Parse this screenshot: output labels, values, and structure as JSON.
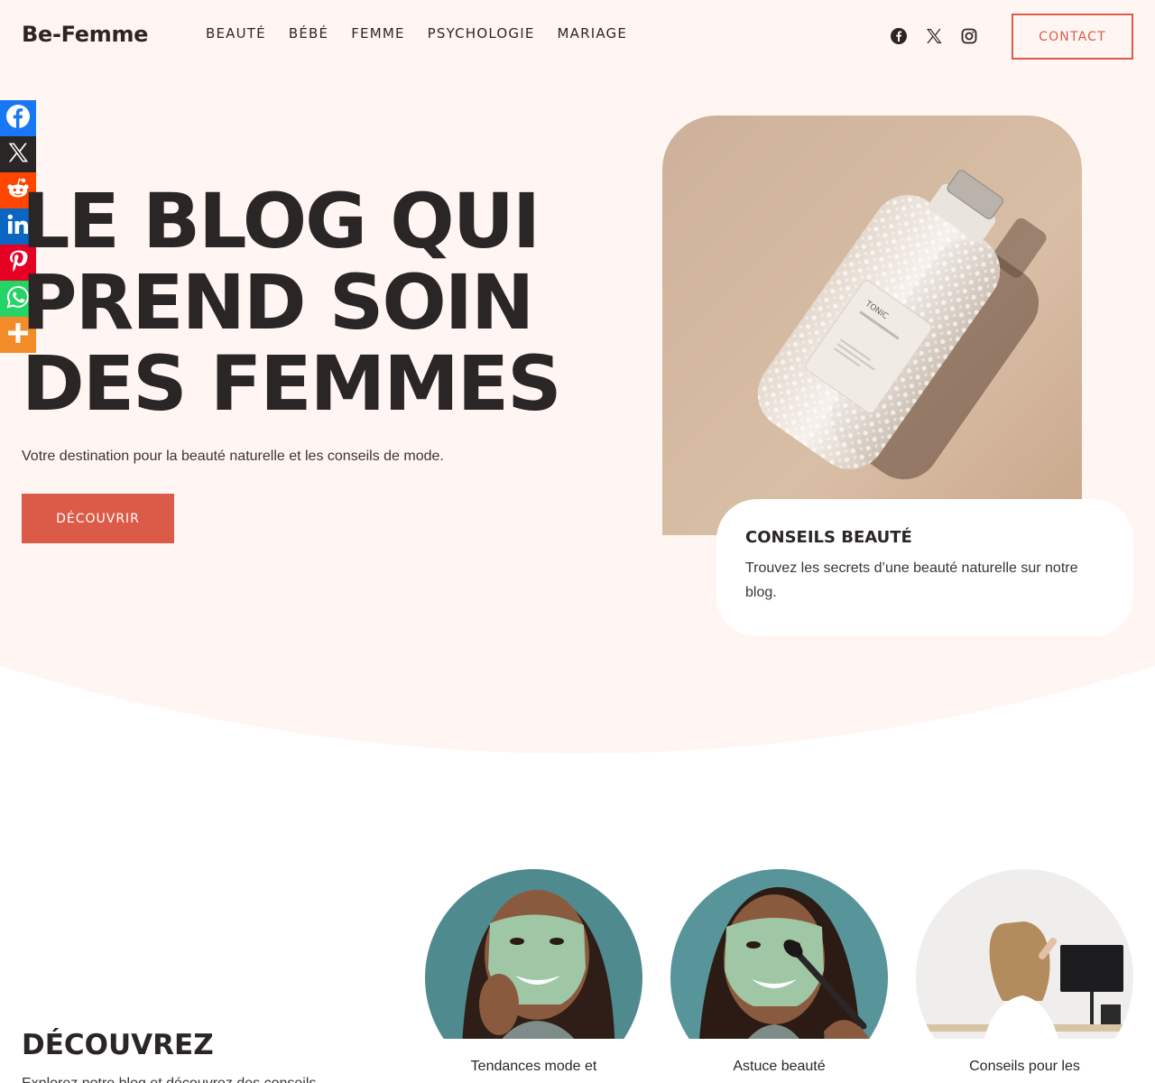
{
  "brand": {
    "logo": "Be-Femme",
    "accent": "#dc5a48",
    "hero_bg": "#fff6f3",
    "text": "#2b2626"
  },
  "nav": {
    "items": [
      "BEAUTÉ",
      "BÉBÉ",
      "FEMME",
      "PSYCHOLOGIE",
      "MARIAGE"
    ]
  },
  "social_icons": [
    "facebook-icon",
    "x-icon",
    "instagram-icon"
  ],
  "contact_label": "CONTACT",
  "share_bar": [
    {
      "name": "Facebook",
      "icon": "facebook-icon",
      "color": "#1877f2"
    },
    {
      "name": "X",
      "icon": "x-icon",
      "color": "#2b2626"
    },
    {
      "name": "Reddit",
      "icon": "reddit-icon",
      "color": "#ff4500"
    },
    {
      "name": "LinkedIn",
      "icon": "linkedin-icon",
      "color": "#0a66c2"
    },
    {
      "name": "Pinterest",
      "icon": "pinterest-icon",
      "color": "#e60023"
    },
    {
      "name": "WhatsApp",
      "icon": "whatsapp-icon",
      "color": "#25d366"
    },
    {
      "name": "More",
      "icon": "plus-icon",
      "color": "#f28c28"
    }
  ],
  "hero": {
    "title_lines": [
      "LE BLOG QUI",
      "PREND SOIN",
      "DES FEMMES"
    ],
    "subtitle": "Votre destination pour la beauté naturelle et les conseils de mode.",
    "cta": "DÉCOUVRIR",
    "image_label": "TONIC"
  },
  "tip_card": {
    "title": "CONSEILS BEAUTÉ",
    "text": "Trouvez les secrets d’une beauté naturelle sur notre blog."
  },
  "discover": {
    "title": "DÉCOUVREZ",
    "text": "Explorez notre blog et découvrez des conseils",
    "cards": [
      {
        "label": "Tendances mode et"
      },
      {
        "label": "Astuce beauté"
      },
      {
        "label": "Conseils pour les"
      }
    ]
  }
}
